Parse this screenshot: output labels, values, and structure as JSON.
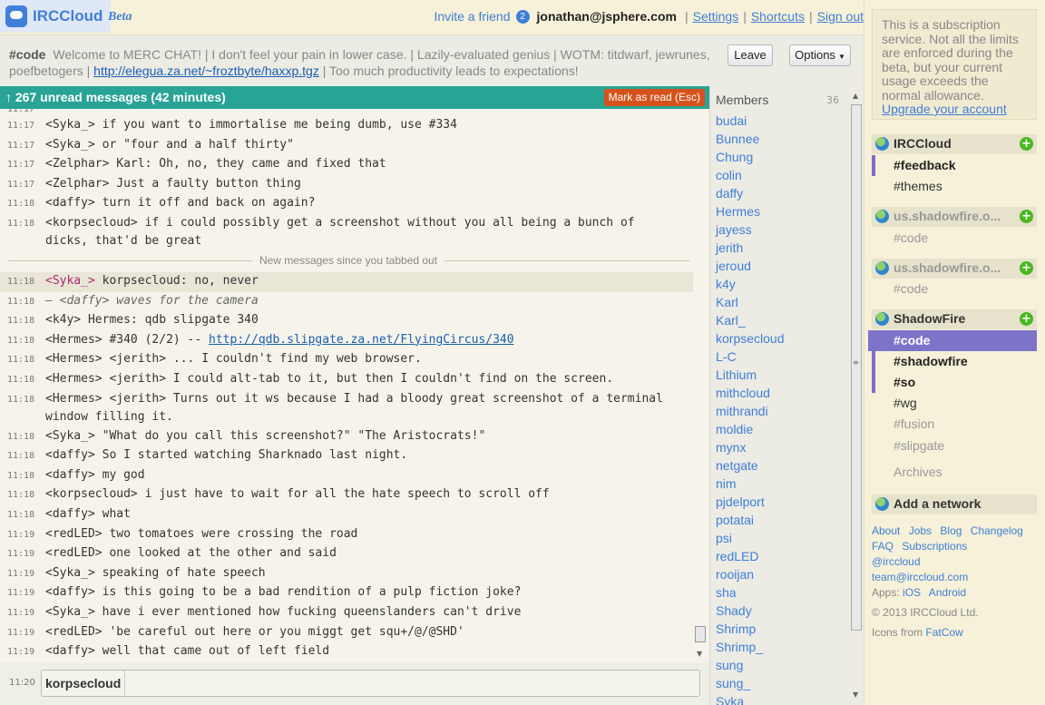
{
  "app": {
    "name": "IRCCloud",
    "tag": "Beta"
  },
  "header": {
    "invite": "Invite a friend",
    "invite_count": "2",
    "email": "jonathan@jsphere.com",
    "settings": "Settings",
    "shortcuts": "Shortcuts",
    "signout": "Sign out"
  },
  "topic": {
    "channel": "#code",
    "text_before": "Welcome to MERC CHAT! | I don't feel your pain in lower case. | Lazily-evaluated genius | WOTM: titdwarf, jewrunes, poefbetogers |",
    "link": "http://elegua.za.net/~froztbyte/haxxp.tgz",
    "text_after": "| Too much productivity leads to expectations!",
    "leave_label": "Leave",
    "options_label": "Options"
  },
  "unread": {
    "label": "↑ 267 unread messages (42 minutes)",
    "mark_read": "Mark as read (Esc)"
  },
  "log": {
    "partial_time": "11:17",
    "divider": "New messages since you tabbed out",
    "before": [
      {
        "time": "11:17",
        "nick": "<Syka_>",
        "text": "if you want to immortalise me being dumb, use #334"
      },
      {
        "time": "11:17",
        "nick": "<Syka_>",
        "text": "or \"four and a half thirty\""
      },
      {
        "time": "11:17",
        "nick": "<Zelphar>",
        "text": "Karl: Oh, no, they came and fixed that"
      },
      {
        "time": "11:17",
        "nick": "<Zelphar>",
        "text": "Just a faulty button thing"
      },
      {
        "time": "11:18",
        "nick": "<daffy>",
        "text": "turn it off and back on again?"
      },
      {
        "time": "11:18",
        "nick": "<korpsecloud>",
        "text": "if i could possibly get a screenshot without you all being a bunch of",
        "cont": "dicks, that'd be great"
      }
    ],
    "after": [
      {
        "time": "11:18",
        "nick": "<Syka_>",
        "text": "korpsecloud: no, never"
      },
      {
        "time": "11:18",
        "action": "— <daffy> waves for the camera"
      },
      {
        "time": "11:18",
        "nick": "<k4y>",
        "text": "Hermes: qdb slipgate 340"
      },
      {
        "time": "11:18",
        "nick": "<Hermes>",
        "text": "#340 (2/2) --",
        "link": "http://qdb.slipgate.za.net/FlyingCircus/340"
      },
      {
        "time": "11:18",
        "nick": "<Hermes>",
        "text": "<jerith> ... I couldn't find my web browser."
      },
      {
        "time": "11:18",
        "nick": "<Hermes>",
        "text": "<jerith> I could alt-tab to it, but then I couldn't find on the screen."
      },
      {
        "time": "11:18",
        "nick": "<Hermes>",
        "text": "<jerith> Turns out it ws because I had a bloody great screenshot of a terminal",
        "cont": "window filling it."
      },
      {
        "time": "11:18",
        "nick": "<Syka_>",
        "text": "\"What do you call this screenshot?\" \"The Aristocrats!\""
      },
      {
        "time": "11:18",
        "nick": "<daffy>",
        "text": "So I started watching Sharknado last night."
      },
      {
        "time": "11:18",
        "nick": "<daffy>",
        "text": "my god"
      },
      {
        "time": "11:18",
        "nick": "<korpsecloud>",
        "text": "i just have to wait for all the hate speech to scroll off"
      },
      {
        "time": "11:18",
        "nick": "<daffy>",
        "text": "what"
      },
      {
        "time": "11:19",
        "nick": "<redLED>",
        "text": "two tomatoes were crossing the road"
      },
      {
        "time": "11:19",
        "nick": "<redLED>",
        "text": "one looked at the other and said"
      },
      {
        "time": "11:19",
        "nick": "<Syka_>",
        "text": "speaking of hate speech"
      },
      {
        "time": "11:19",
        "nick": "<daffy>",
        "text": "is this going to be a bad rendition of a pulp fiction joke?"
      },
      {
        "time": "11:19",
        "nick": "<Syka_>",
        "text": "have i ever mentioned how fucking queenslanders can't drive"
      },
      {
        "time": "11:19",
        "nick": "<redLED>",
        "text": "'be careful out here or you miggt get squ+/@/@SHD'"
      },
      {
        "time": "11:19",
        "nick": "<daffy>",
        "text": "well that came out of left field"
      }
    ]
  },
  "input": {
    "time": "11:20",
    "nick": "korpsecloud"
  },
  "members": {
    "title": "Members",
    "count": "36",
    "list": [
      "budai",
      "Bunnee",
      "Chung",
      "colin",
      "daffy",
      "Hermes",
      "jayess",
      "jerith",
      "jeroud",
      "k4y",
      "Karl",
      "Karl_",
      "korpsecloud",
      "L-C",
      "Lithium",
      "mithcloud",
      "mithrandi",
      "moldie",
      "mynx",
      "netgate",
      "nim",
      "pjdelport",
      "potatai",
      "psi",
      "redLED",
      "rooijan",
      "sha",
      "Shady",
      "Shrimp",
      "Shrimp_",
      "sung",
      "sung_",
      "Syka"
    ]
  },
  "sidebar": {
    "notice": "This is a subscription service. Not all the limits are enforced during the beta, but your current usage exceeds the normal allowance.",
    "upgrade": "Upgrade your account",
    "networks": [
      {
        "name": "IRCCloud",
        "channels": [
          "#feedback",
          "#themes"
        ]
      },
      {
        "name": "us.shadowfire.o...",
        "channels": [
          "#code"
        ]
      },
      {
        "name": "us.shadowfire.o...",
        "channels": [
          "#code"
        ]
      },
      {
        "name": "ShadowFire",
        "channels": [
          "#code",
          "#shadowfire",
          "#so",
          "#wg",
          "#fusion",
          "#slipgate"
        ],
        "archives": "Archives"
      }
    ],
    "add_network": "Add a network",
    "footer": {
      "links1": [
        "About",
        "Jobs",
        "Blog",
        "Changelog"
      ],
      "links2": [
        "FAQ",
        "Subscriptions"
      ],
      "handle": "@irccloud",
      "email": "team@irccloud.com",
      "apps_label": "Apps:",
      "apps": [
        "iOS",
        "Android"
      ],
      "copyright": "© 2013 IRCCloud Ltd.",
      "icons_prefix": "Icons from",
      "icons_link": "FatCow"
    }
  },
  "colors": {
    "accent": "#3f7fd8",
    "unread_bar": "#28a396",
    "mark_read": "#d6521c",
    "selected_channel": "#7d73c9",
    "nick_highlight": "#b0286e",
    "add_icon": "#49b820"
  }
}
